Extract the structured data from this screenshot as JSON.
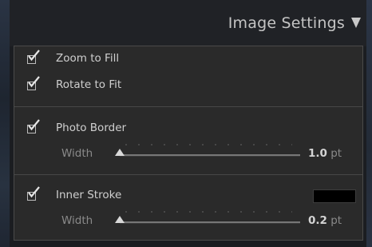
{
  "header": {
    "title": "Image Settings",
    "collapse_icon": "triangle-down-icon"
  },
  "options": {
    "zoom_to_fill": {
      "label": "Zoom to Fill",
      "checked": true
    },
    "rotate_to_fit": {
      "label": "Rotate to Fit",
      "checked": true
    }
  },
  "photo_border": {
    "label": "Photo Border",
    "checked": true,
    "width_label": "Width",
    "width_value": "1.0",
    "unit": "pt",
    "slider_fraction": 0.0
  },
  "inner_stroke": {
    "label": "Inner Stroke",
    "checked": true,
    "color": "#000000",
    "width_label": "Width",
    "width_value": "0.2",
    "unit": "pt",
    "slider_fraction": 0.0
  },
  "colors": {
    "panel_bg": "#2a2a2a",
    "header_bg": "#202226",
    "text": "#cfcfcf",
    "muted_text": "#8a8a8a"
  }
}
